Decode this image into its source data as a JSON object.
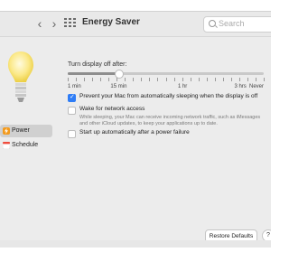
{
  "window": {
    "title": "Energy Saver"
  },
  "toolbar": {
    "back_glyph": "‹",
    "forward_glyph": "›",
    "search": {
      "placeholder": "Search"
    }
  },
  "sidebar": {
    "items": [
      {
        "label": "Power",
        "icon": "bolt-icon",
        "active": true
      },
      {
        "label": "Schedule",
        "icon": "calendar-icon",
        "active": false
      }
    ]
  },
  "display_sleep": {
    "label": "Turn display off after:",
    "value_fraction": 0.26,
    "ticks": [
      "1 min",
      "15 min",
      "1 hr",
      "3 hrs",
      "Never"
    ]
  },
  "options": [
    {
      "label": "Prevent your Mac from automatically sleeping when the display is off",
      "checked": true
    },
    {
      "label": "Wake for network access",
      "checked": false,
      "description": "While sleeping, your Mac can receive incoming network traffic, such as iMessages and other iCloud updates, to keep your applications up to date."
    },
    {
      "label": "Start up automatically after a power failure",
      "checked": false
    }
  ],
  "footer": {
    "restore_label": "Restore Defaults",
    "help_label": "?"
  },
  "colors": {
    "accent": "#2f7df6",
    "window_bg": "#ececec"
  }
}
